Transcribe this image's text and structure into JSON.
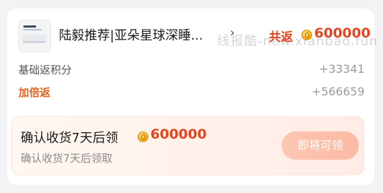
{
  "product": {
    "title": "陆毅推荐|亚朵星球深睡...",
    "chevron": "›",
    "total_label": "共返",
    "total_value": "600000",
    "watermark": "线报酷-new.xianbao.fun"
  },
  "points": {
    "base_label": "基础返积分",
    "base_value": "+33341",
    "double_label": "加倍返",
    "double_value": "+566659"
  },
  "confirm": {
    "title": "确认收货7天后领",
    "value": "600000",
    "subtitle": "确认收货7天后领取",
    "button_label": "即将可领"
  },
  "colors": {
    "accent": "#e8431c",
    "double_label": "#e8621c",
    "button": "#fbb9a2"
  },
  "icons": {
    "coin": "coin-icon",
    "chevron": "chevron-right-icon"
  }
}
